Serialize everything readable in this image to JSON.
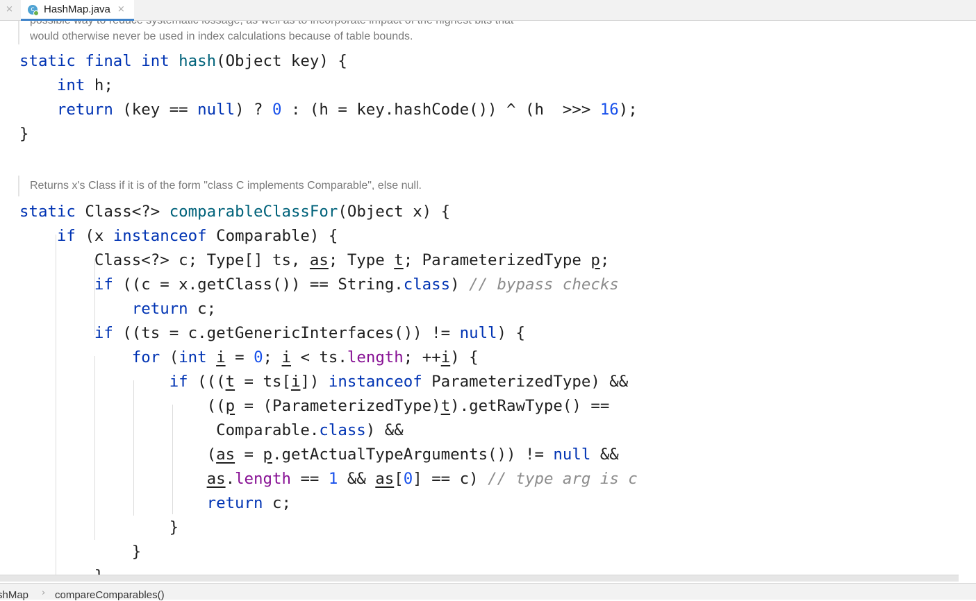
{
  "tab": {
    "close_left": "×",
    "icon_letter": "c",
    "label": "HashMap.java",
    "close": "×"
  },
  "doc": {
    "line_clipped": "possible way to reduce systematic lossage, as well as to incorporate impact of the highest bits that",
    "line_2": "would otherwise never be used in index calculations because of table bounds.",
    "comparable_doc": "Returns x's Class if it is of the form \"class C implements Comparable\", else null."
  },
  "code": {
    "hash_sig": [
      "static final int ",
      "hash",
      "(Object key) {"
    ],
    "hash_l1": [
      "    ",
      "int",
      " h;"
    ],
    "hash_l2": [
      "    ",
      "return",
      " (key ",
      "==",
      " ",
      "null",
      ") ? ",
      "0",
      " : (h = key.hashCode()) ^ (h  >>> ",
      "16",
      ");"
    ],
    "hash_end": "}",
    "cc_sig": [
      "static ",
      "Class<?> ",
      "comparableClassFor",
      "(Object x) {"
    ],
    "l1": [
      "    ",
      "if",
      " (x ",
      "instanceof",
      " Comparable) {"
    ],
    "l2": [
      "        Class<?> c; Type[] ts, ",
      "as",
      "; Type ",
      "t",
      "; ParameterizedType ",
      "p",
      ";"
    ],
    "l3": [
      "        ",
      "if",
      " ((c = x.getClass()) ",
      "==",
      " String.",
      "class",
      ") ",
      "// bypass checks"
    ],
    "l4": [
      "            ",
      "return",
      " c;"
    ],
    "l5": [
      "        ",
      "if",
      " ((ts = c.getGenericInterfaces()) ",
      "!=",
      " ",
      "null",
      ") {"
    ],
    "l6": [
      "            ",
      "for",
      " (",
      "int",
      " ",
      "i",
      " = ",
      "0",
      "; ",
      "i",
      " < ts.",
      "length",
      "; ",
      "++",
      "i",
      ") {"
    ],
    "l7": [
      "                ",
      "if",
      " (((",
      "t",
      " = ts[",
      "i",
      "]) ",
      "instanceof",
      " ParameterizedType) &&"
    ],
    "l8": [
      "                    ((",
      "p",
      " = (ParameterizedType)",
      "t",
      ").getRawType() ",
      "=="
    ],
    "l9": [
      "                     Comparable.",
      "class",
      ") &&"
    ],
    "l10": [
      "                    (",
      "as",
      " = ",
      "p",
      ".getActualTypeArguments()) ",
      "!=",
      " ",
      "null",
      " &&"
    ],
    "l11": [
      "                    ",
      "as",
      ".",
      "length",
      " ",
      "==",
      " ",
      "1",
      " && ",
      "as",
      "[",
      "0",
      "] ",
      "==",
      " c) ",
      "// type arg is c"
    ],
    "l12": [
      "                    ",
      "return",
      " c;"
    ],
    "l13": "                }",
    "l14": "            }",
    "l15": "        }"
  },
  "status": {
    "crumb_class": "shMap",
    "crumb_sep": "›",
    "crumb_method": "compareComparables()"
  },
  "colors": {
    "keyword": "#0033b3",
    "number": "#1750eb",
    "method_decl": "#00627a",
    "field": "#871094",
    "comment": "#8c8c8c",
    "tab_underline": "#4083c9"
  }
}
